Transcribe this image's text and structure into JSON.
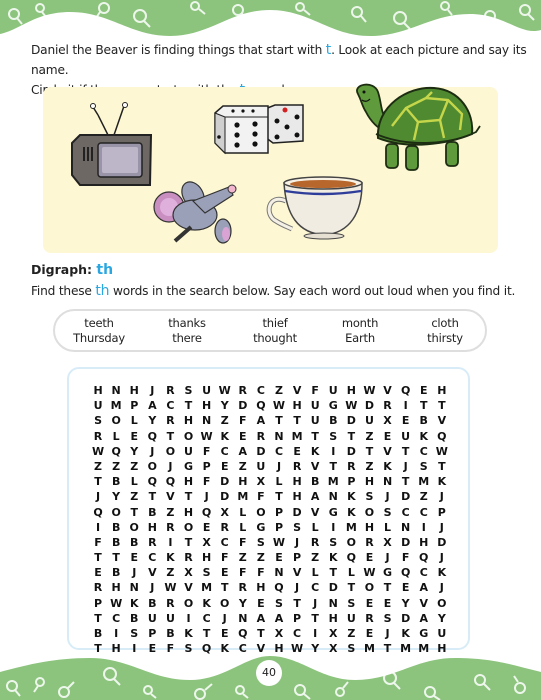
{
  "instructions": {
    "line1_pre": "Daniel the Beaver is finding things that start with ",
    "letter": "t",
    "line1_post": ".  Look at each picture and say its name.",
    "line2_pre": "Circle it if the name starts with the ",
    "line2_post": " sound."
  },
  "pictures": [
    {
      "name": "television",
      "icon": "tv-icon"
    },
    {
      "name": "dice",
      "icon": "dice-icon"
    },
    {
      "name": "turtle",
      "icon": "turtle-icon"
    },
    {
      "name": "mouse",
      "icon": "mouse-icon"
    },
    {
      "name": "teacup",
      "icon": "teacup-icon"
    }
  ],
  "section": {
    "heading_label": "Digraph: ",
    "heading_digraph": "th",
    "instr_pre": "Find these ",
    "instr_digraph": "th",
    "instr_post": " words in the search below. Say each word out loud when you find it."
  },
  "word_bank": [
    [
      "teeth",
      "Thursday"
    ],
    [
      "thanks",
      "there"
    ],
    [
      "thief",
      "thought"
    ],
    [
      "month",
      "Earth"
    ],
    [
      "cloth",
      "thirsty"
    ]
  ],
  "grid": [
    "HNHJRSUWRCZVFUHWVQEH",
    "UMPACTHYDQWHUGWDRITT",
    "SOLYRHNZFATTUBDUXEBV",
    "RLEQTOWKERNMTSTZEUKQ",
    "WQYJOUFCADCEKIDTVTCW",
    "ZZZOJGPEZUJRVTRZKJST",
    "TBLQQHFDHXLHBMPHNTMK",
    "JYZTVTJDMFTHANKSJDZJ",
    "QOTBZHQXLOPDVGKOSCCP",
    "IBOHROERLGPSLIMHLNIJ",
    "FBBRITXCFSWJRSORXDHD",
    "TTECKRHFZZEPZKQEJFQJ",
    "EBJVZXSEFFNVLTLWGQCK",
    "RHNJWVMTRHQJCDTOTEAJ",
    "PWKBROKOYESTJNSEEYVO",
    "TCBUUICJNAAPTHURSDAY",
    "BISPBKTEQTXCIXZEJKGU",
    "THIEFSQKCVHWYXSMTMMH"
  ],
  "page_number": "40",
  "colors": {
    "border_green": "#8cc47d",
    "accent_blue": "#2aa6e0",
    "panel_yellow": "#fdf7d3"
  }
}
